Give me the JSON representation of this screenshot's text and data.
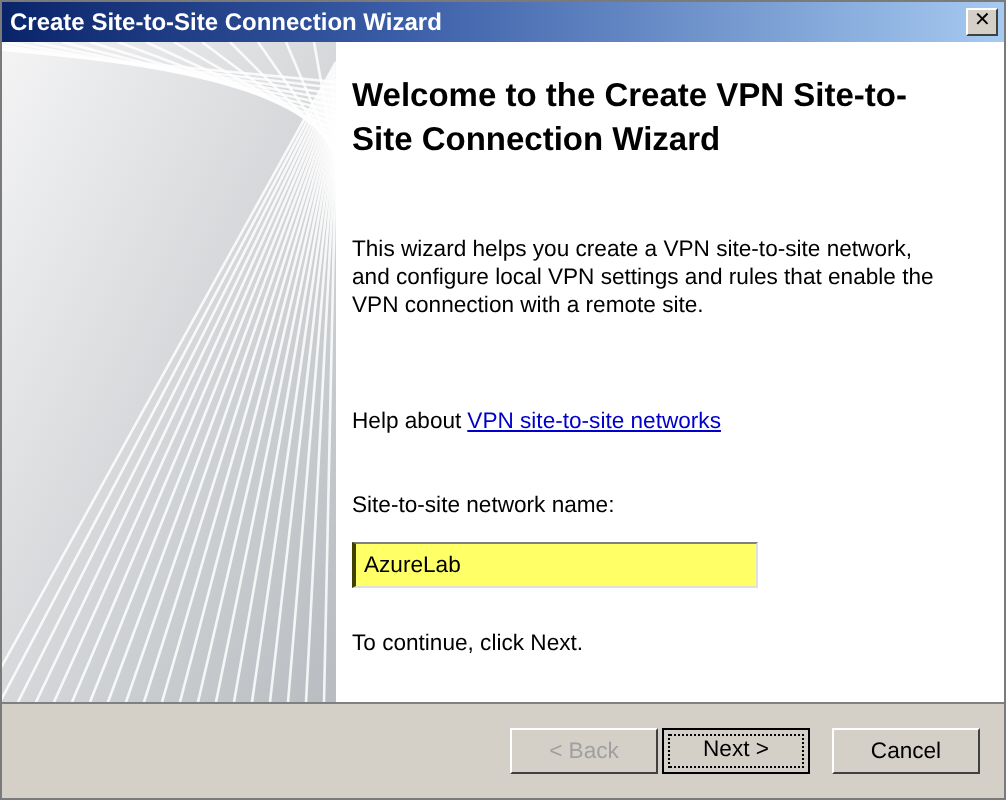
{
  "window": {
    "title": "Create Site-to-Site Connection Wizard",
    "close": "✕"
  },
  "heading": "Welcome to the Create VPN Site-to-Site Connection Wizard",
  "description": "This wizard helps you create a VPN site-to-site network, and configure local VPN settings and rules that enable the VPN connection with a remote site.",
  "help": {
    "prefix": "Help about",
    "link": "VPN site-to-site networks"
  },
  "name_field": {
    "label": "Site-to-site network name:",
    "value": "AzureLab"
  },
  "footer_text": "To continue, click Next.",
  "buttons": [
    {
      "label": "< Back",
      "disabled": true,
      "focused": false
    },
    {
      "label": "Next >",
      "disabled": false,
      "focused": true
    },
    {
      "label": "Cancel",
      "disabled": false,
      "focused": false
    }
  ]
}
